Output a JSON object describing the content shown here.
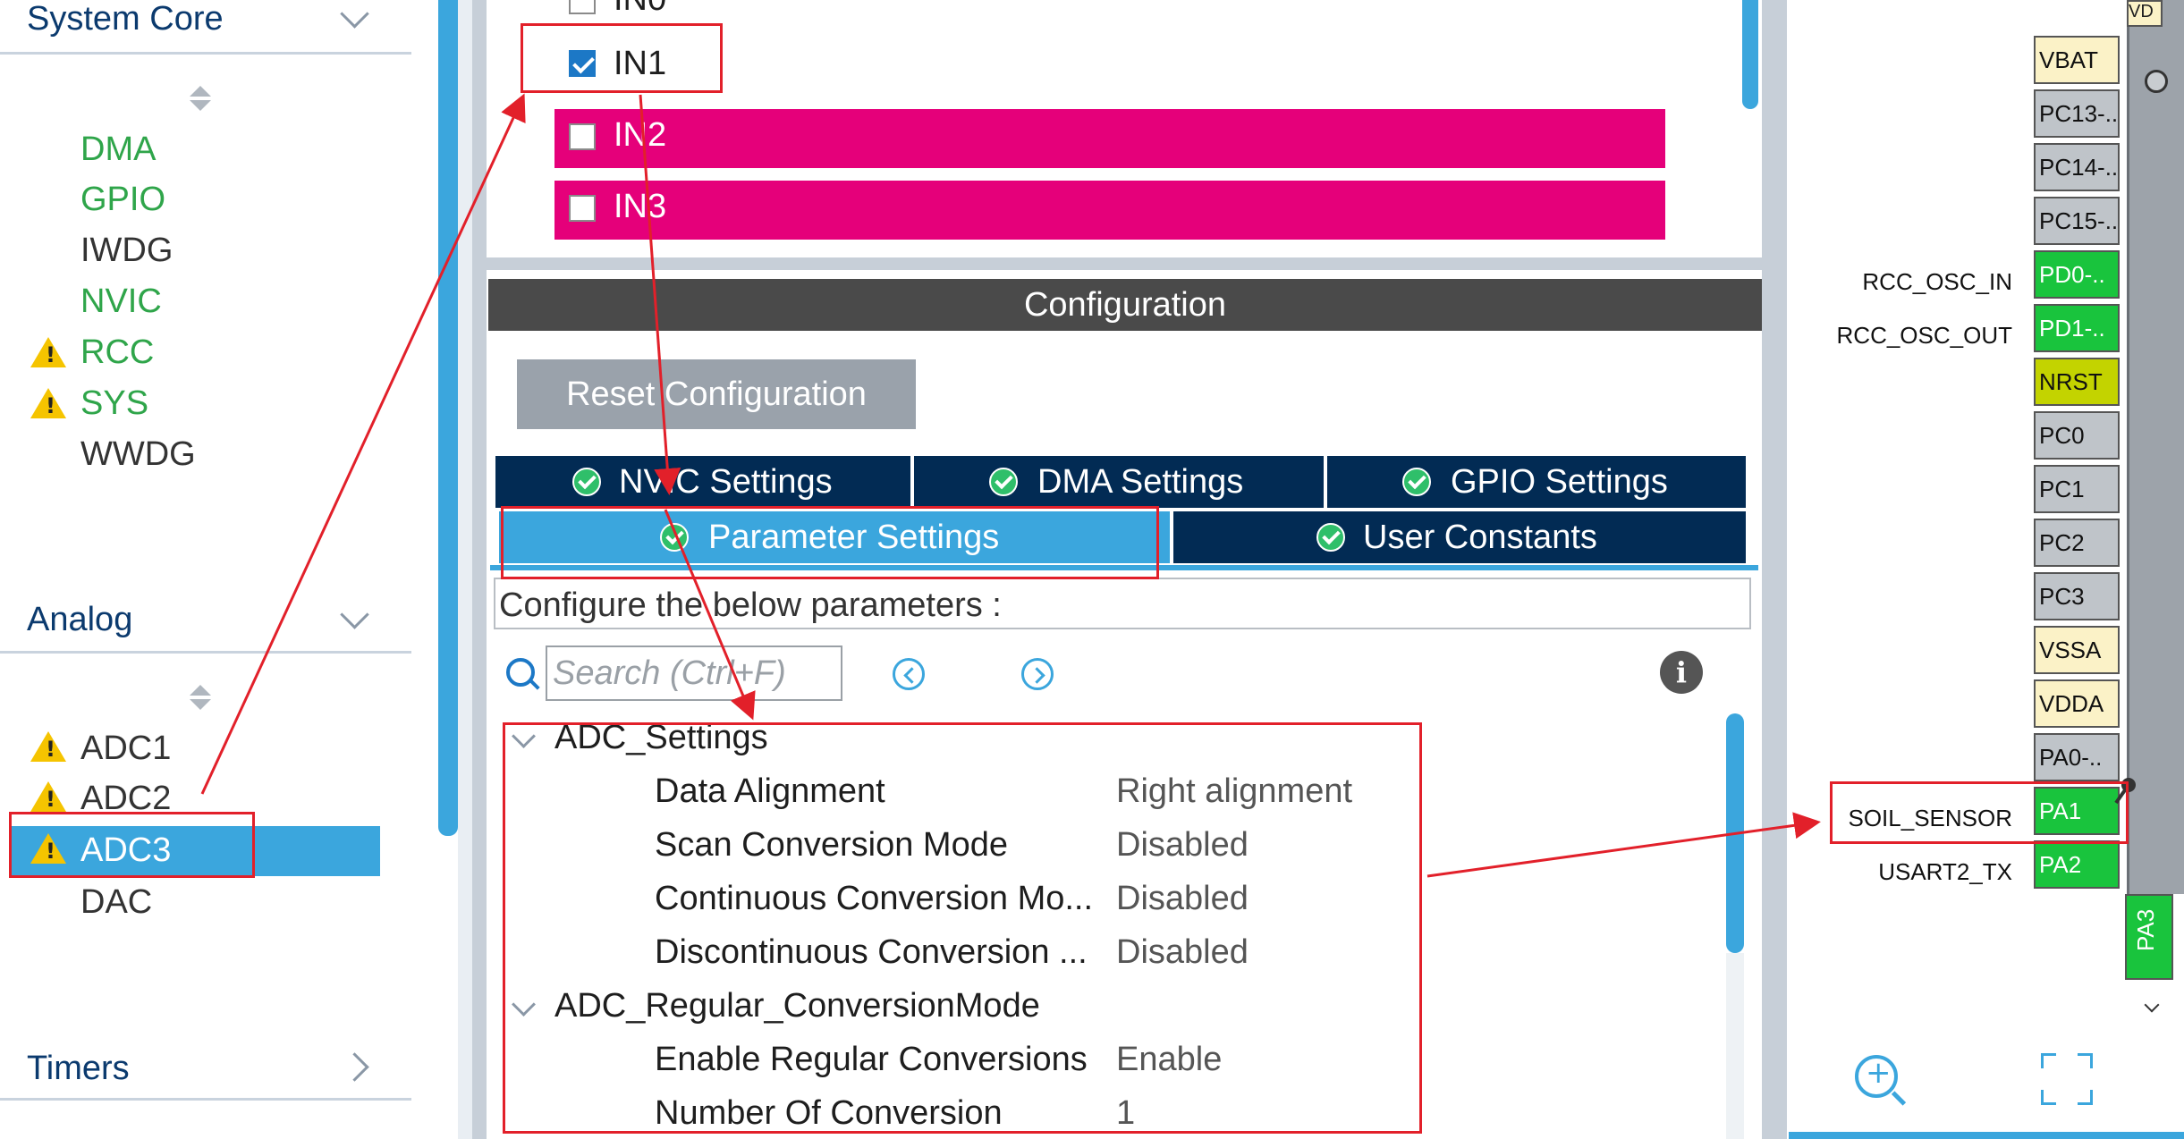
{
  "left_panel": {
    "system_core": {
      "title": "System Core",
      "items": [
        {
          "label": "DMA",
          "color": "#2fa54a",
          "warning": false
        },
        {
          "label": "GPIO",
          "color": "#2fa54a",
          "warning": false
        },
        {
          "label": "IWDG",
          "color": "#333333",
          "warning": false
        },
        {
          "label": "NVIC",
          "color": "#2fa54a",
          "warning": false
        },
        {
          "label": "RCC",
          "color": "#2fa54a",
          "warning": true
        },
        {
          "label": "SYS",
          "color": "#2fa54a",
          "warning": true
        },
        {
          "label": "WWDG",
          "color": "#333333",
          "warning": false
        }
      ]
    },
    "analog": {
      "title": "Analog",
      "items": [
        {
          "label": "ADC1",
          "warning": true
        },
        {
          "label": "ADC2",
          "warning": true
        },
        {
          "label": "ADC3",
          "warning": true,
          "selected": true
        },
        {
          "label": "DAC",
          "warning": false
        }
      ]
    },
    "timers": {
      "title": "Timers"
    }
  },
  "mode": {
    "channels": [
      {
        "label": "IN0",
        "checked": false
      },
      {
        "label": "IN1",
        "checked": true
      },
      {
        "label": "IN2",
        "checked": false
      },
      {
        "label": "IN3",
        "checked": false
      }
    ]
  },
  "configuration": {
    "title": "Configuration",
    "reset_label": "Reset Configuration",
    "tabs_row1": [
      "NVIC Settings",
      "DMA Settings",
      "GPIO Settings"
    ],
    "tabs_row2": [
      "Parameter Settings",
      "User Constants"
    ],
    "active_tab": "Parameter Settings",
    "configure_text": "Configure the below parameters :",
    "search_placeholder": "Search (Ctrl+F)",
    "groups": [
      {
        "label": "ADC_Settings",
        "params": [
          {
            "name": "Data Alignment",
            "value": "Right alignment"
          },
          {
            "name": "Scan Conversion Mode",
            "value": "Disabled"
          },
          {
            "name": "Continuous Conversion Mo...",
            "value": "Disabled"
          },
          {
            "name": "Discontinuous Conversion ...",
            "value": "Disabled"
          }
        ]
      },
      {
        "label": "ADC_Regular_ConversionMode",
        "params": [
          {
            "name": "Enable Regular Conversions",
            "value": "Enable"
          },
          {
            "name": "Number Of Conversion",
            "value": "1"
          }
        ]
      }
    ]
  },
  "chip": {
    "top_pin_label": "VD",
    "pins": [
      {
        "name": "VBAT",
        "label": "",
        "color": "yellow"
      },
      {
        "name": "PC13-..",
        "label": "",
        "color": "gray"
      },
      {
        "name": "PC14-..",
        "label": "",
        "color": "gray"
      },
      {
        "name": "PC15-..",
        "label": "",
        "color": "gray"
      },
      {
        "name": "PD0-..",
        "label": "RCC_OSC_IN",
        "color": "green"
      },
      {
        "name": "PD1-..",
        "label": "RCC_OSC_OUT",
        "color": "green"
      },
      {
        "name": "NRST",
        "label": "",
        "color": "olive"
      },
      {
        "name": "PC0",
        "label": "",
        "color": "gray"
      },
      {
        "name": "PC1",
        "label": "",
        "color": "gray"
      },
      {
        "name": "PC2",
        "label": "",
        "color": "gray"
      },
      {
        "name": "PC3",
        "label": "",
        "color": "gray"
      },
      {
        "name": "VSSA",
        "label": "",
        "color": "yellow"
      },
      {
        "name": "VDDA",
        "label": "",
        "color": "yellow"
      },
      {
        "name": "PA0-..",
        "label": "",
        "color": "gray"
      },
      {
        "name": "PA1",
        "label": "SOIL_SENSOR",
        "color": "green"
      },
      {
        "name": "PA2",
        "label": "USART2_TX",
        "color": "green"
      }
    ],
    "bottom_pin": "PA3"
  }
}
